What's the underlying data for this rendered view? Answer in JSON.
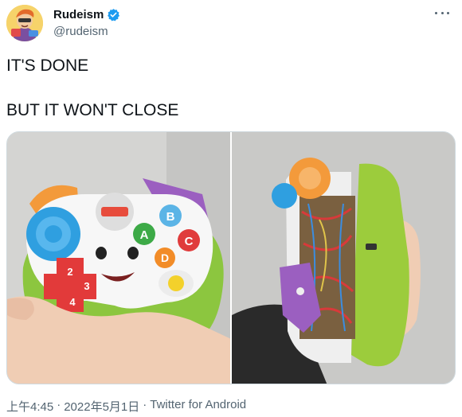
{
  "author": {
    "display_name": "Rudeism",
    "handle": "@rudeism",
    "verified": true,
    "avatar_icon": "avatar-cartoon-icon"
  },
  "tweet": {
    "lines": [
      "IT'S DONE",
      "BUT IT WON'T CLOSE"
    ]
  },
  "media": {
    "count": 2,
    "items": [
      {
        "kind": "photo",
        "icon": "toy-controller-front-photo"
      },
      {
        "kind": "photo",
        "icon": "toy-controller-open-photo"
      }
    ]
  },
  "meta": {
    "time": "上午4:45",
    "separator": "·",
    "date": "2022年5月1日",
    "source": "Twitter for Android"
  },
  "colors": {
    "verified_blue": "#1d9bf0",
    "text_primary": "#0f1419",
    "text_secondary": "#536471",
    "border": "#cfd9de"
  }
}
